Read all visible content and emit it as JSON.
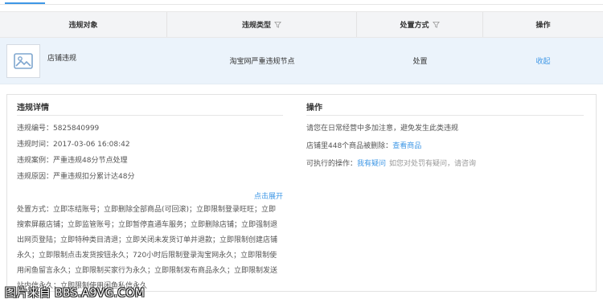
{
  "table": {
    "headers": {
      "object": "违规对象",
      "type": "违规类型",
      "method": "处置方式",
      "action": "操作"
    },
    "row": {
      "object_name": "店铺违规",
      "type": "淘宝网严重违规节点",
      "method": "处置",
      "action": "收起"
    }
  },
  "details": {
    "title": "违规详情",
    "fields": [
      {
        "label": "违规编号：",
        "value": "5825840999"
      },
      {
        "label": "违规时间：",
        "value": "2017-03-06 16:08:42"
      },
      {
        "label": "违规案例：",
        "value": "严重违规48分节点处理"
      },
      {
        "label": "违规原因：",
        "value": "严重违规扣分累计达48分"
      }
    ],
    "expand_label": "点击展开",
    "measures_label": "处置方式：",
    "measures_text": "立即冻结账号；立即删除全部商品(可回滚)；立即限制登录旺旺；立即搜索屏蔽店铺；立即监管账号；立即暂停直通车服务；立即删除店铺；立即强制退出网页登陆；立即特种类目清退；立即关闭未发货订单并退款；立即限制创建店铺永久；立即限制点击发货按钮永久；720小时后限制登录淘宝网永久；立即限制使用闲鱼留言永久；立即限制买家行为永久；立即限制发布商品永久；立即限制发送站内信永久；立即限制使用闲鱼私信永久"
  },
  "operations": {
    "title": "操作",
    "notice": "请您在日常经营中多加注意，避免发生此类违规",
    "deleted_prefix": "店铺里448个商品被删除：",
    "view_goods": "查看商品",
    "executable_label": "可执行的操作：",
    "question_link": "我有疑问",
    "question_hint": "如您对处罚有疑问，请咨询"
  },
  "watermark": "图片来自 BBS.A9VG.COM",
  "colors": {
    "accent": "#3e97e6",
    "row_bg": "#ebf3fb",
    "header_bg": "#f3f4f6"
  }
}
